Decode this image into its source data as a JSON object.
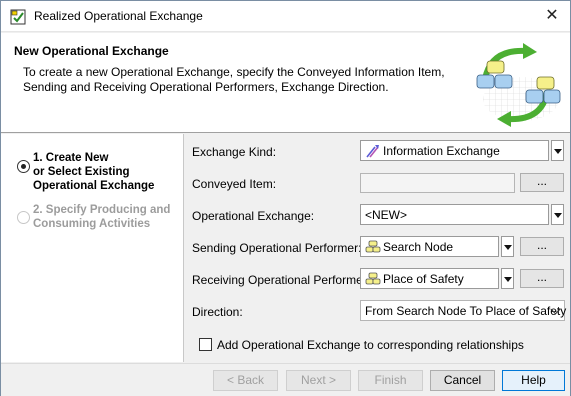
{
  "window": {
    "title": "Realized Operational Exchange",
    "close_glyph": "✕"
  },
  "banner": {
    "heading": "New Operational Exchange",
    "description": "To create a new Operational Exchange, specify the Conveyed Information Item, Sending and Receiving Operational Performers, Exchange Direction."
  },
  "steps": [
    {
      "label": "1. Create New or Select Existing Operational Exchange",
      "line1": "1. Create New",
      "line2": "or Select Existing",
      "line3": "Operational Exchange",
      "selected": true,
      "enabled": true
    },
    {
      "label": "2. Specify Producing and Consuming Activities",
      "line1": "2. Specify Producing and",
      "line2": "Consuming Activities",
      "selected": false,
      "enabled": false
    }
  ],
  "form": {
    "exchange_kind": {
      "label": "Exchange Kind:",
      "value": "Information Exchange",
      "icon": "information-exchange-icon"
    },
    "conveyed_item": {
      "label": "Conveyed Item:",
      "value": "",
      "browse": "..."
    },
    "operational_exchange": {
      "label": "Operational Exchange:",
      "value": "<NEW>"
    },
    "sending_performer": {
      "label": "Sending Operational Performer:",
      "value": "Search Node",
      "icon": "performer-icon",
      "browse": "..."
    },
    "receiving_performer": {
      "label": "Receiving Operational Performer:",
      "value": "Place of Safety",
      "icon": "performer-icon",
      "browse": "..."
    },
    "direction": {
      "label": "Direction:",
      "value": "From Search Node To Place of Safety"
    },
    "add_to_relationships": {
      "label": "Add Operational Exchange to corresponding relationships",
      "checked": false
    }
  },
  "footer": {
    "back": "< Back",
    "next": "Next >",
    "finish": "Finish",
    "cancel": "Cancel",
    "help": "Help"
  },
  "colors": {
    "accent": "#0078d7",
    "disabled_text": "#9c9c9c"
  }
}
